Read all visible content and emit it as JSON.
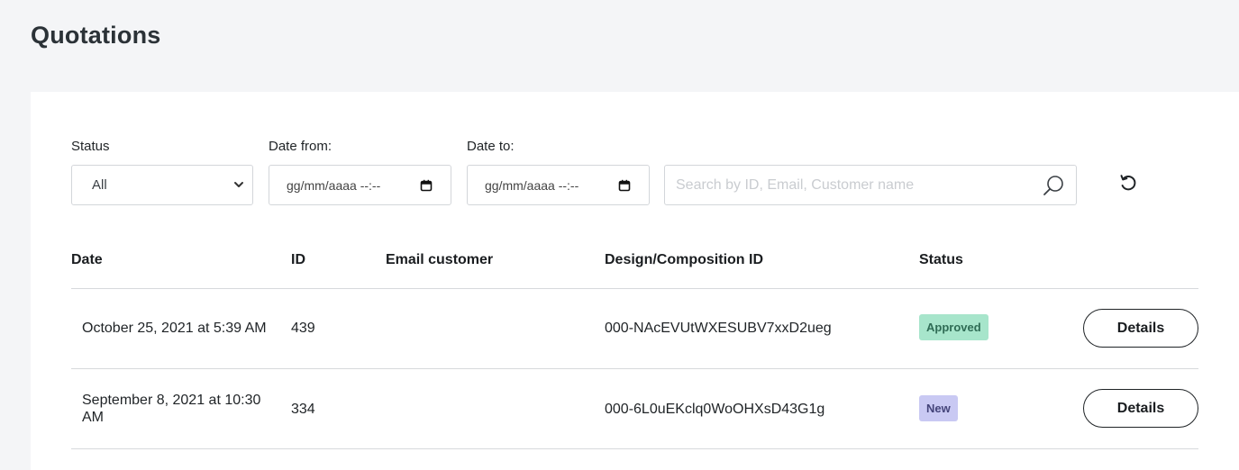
{
  "page": {
    "title": "Quotations"
  },
  "filters": {
    "status_label": "Status",
    "status_value": "All",
    "date_from_label": "Date from:",
    "date_from_value": "gg/mm/aaaa --:--",
    "date_to_label": "Date to:",
    "date_to_value": "gg/mm/aaaa --:--",
    "search_placeholder": "Search by ID, Email, Customer name"
  },
  "table": {
    "headers": {
      "date": "Date",
      "id": "ID",
      "email": "Email customer",
      "design": "Design/Composition ID",
      "status": "Status"
    },
    "rows": [
      {
        "date_line1": "October 25, 2021 at 5:39 AM",
        "date_line2": "",
        "id": "439",
        "email": "",
        "design_id": "000-NAcEVUtWXESUBV7xxD2ueg",
        "status": "Approved",
        "action": "Details"
      },
      {
        "date_line1": "September 8, 2021 at 10:30",
        "date_line2": "AM",
        "id": "334",
        "email": "",
        "design_id": "000-6L0uEKclq0WoOHXsD43G1g",
        "status": "New",
        "action": "Details"
      }
    ]
  },
  "colors": {
    "badge_approved_bg": "#a7e5cb",
    "badge_new_bg": "#c9c9f3",
    "page_bg": "#f4f5f7"
  },
  "icons": {
    "status_select": "chevron-down-icon",
    "date_picker": "calendar-icon",
    "search": "search-icon",
    "reset": "reset-icon"
  }
}
